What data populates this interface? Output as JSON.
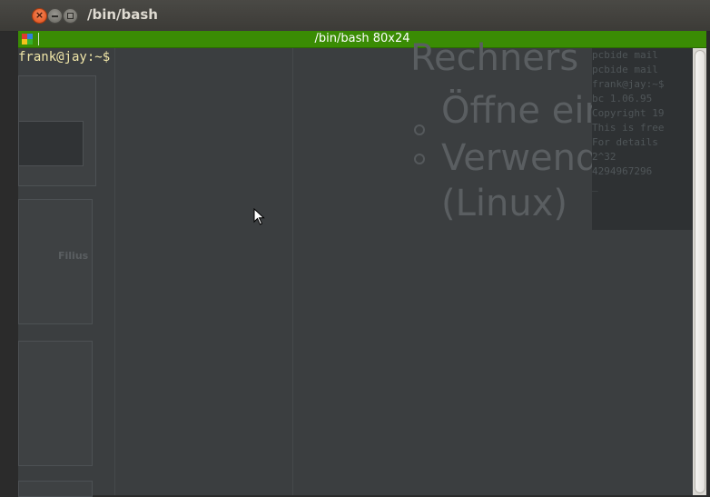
{
  "window": {
    "title": "/bin/bash",
    "close_glyph": "×"
  },
  "terminal": {
    "header_text": "/bin/bash 80x24",
    "prompt": "frank@jay:~$"
  },
  "background": {
    "slide_lines": [
      "Rechners",
      "Öffne ein",
      "Verwend",
      "(Linux)"
    ],
    "sidebar_label": "Filius",
    "small_terminal_lines": [
      "pcbide mail",
      "pcbide mail",
      "frank@jay:~$",
      "bc 1.06.95",
      "Copyright 19",
      "This is free",
      "For details",
      "2^32",
      "4294967296",
      "_"
    ]
  },
  "colors": {
    "terminal_bar": "#3a8c04",
    "prompt_text": "#f0e6a8",
    "close_button": "#df4b16"
  },
  "icons": {
    "terminal_logo": "terminal-app-icon",
    "pointer": "mouse-pointer-icon"
  }
}
